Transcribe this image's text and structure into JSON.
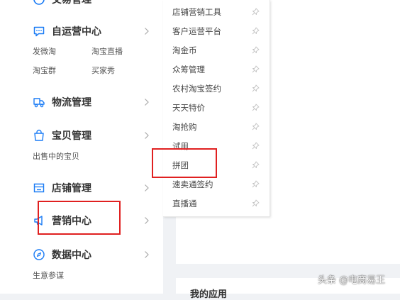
{
  "sidebar": {
    "top_partial_title": "交易管理",
    "sections": {
      "self_op": {
        "title": "自运营中心",
        "links": [
          "发微淘",
          "淘宝直播",
          "淘宝群",
          "买家秀"
        ]
      },
      "logistics": {
        "title": "物流管理"
      },
      "goods": {
        "title": "宝贝管理",
        "links": [
          "出售中的宝贝"
        ]
      },
      "shop": {
        "title": "店铺管理"
      },
      "marketing": {
        "title": "营销中心"
      },
      "data": {
        "title": "数据中心",
        "links": [
          "生意参谋"
        ]
      }
    }
  },
  "flyout": {
    "items": [
      "店铺营销工具",
      "客户运营平台",
      "淘金币",
      "众筹管理",
      "农村淘宝签约",
      "天天特价",
      "淘抢购",
      "试用",
      "拼团",
      "速卖通签约",
      "直播通"
    ]
  },
  "main": {
    "second_card_title": "我的应用"
  },
  "watermark": "头条 @电商易王",
  "colors": {
    "accent": "#1b7cf5",
    "highlight_box": "#e02020"
  },
  "icons": {
    "self_op": "chat-bubble-icon",
    "logistics": "truck-icon",
    "goods": "shopping-bag-icon",
    "shop": "storefront-icon",
    "marketing": "megaphone-icon",
    "data": "compass-icon",
    "pin": "pin-icon",
    "chevron": "chevron-right-icon"
  }
}
